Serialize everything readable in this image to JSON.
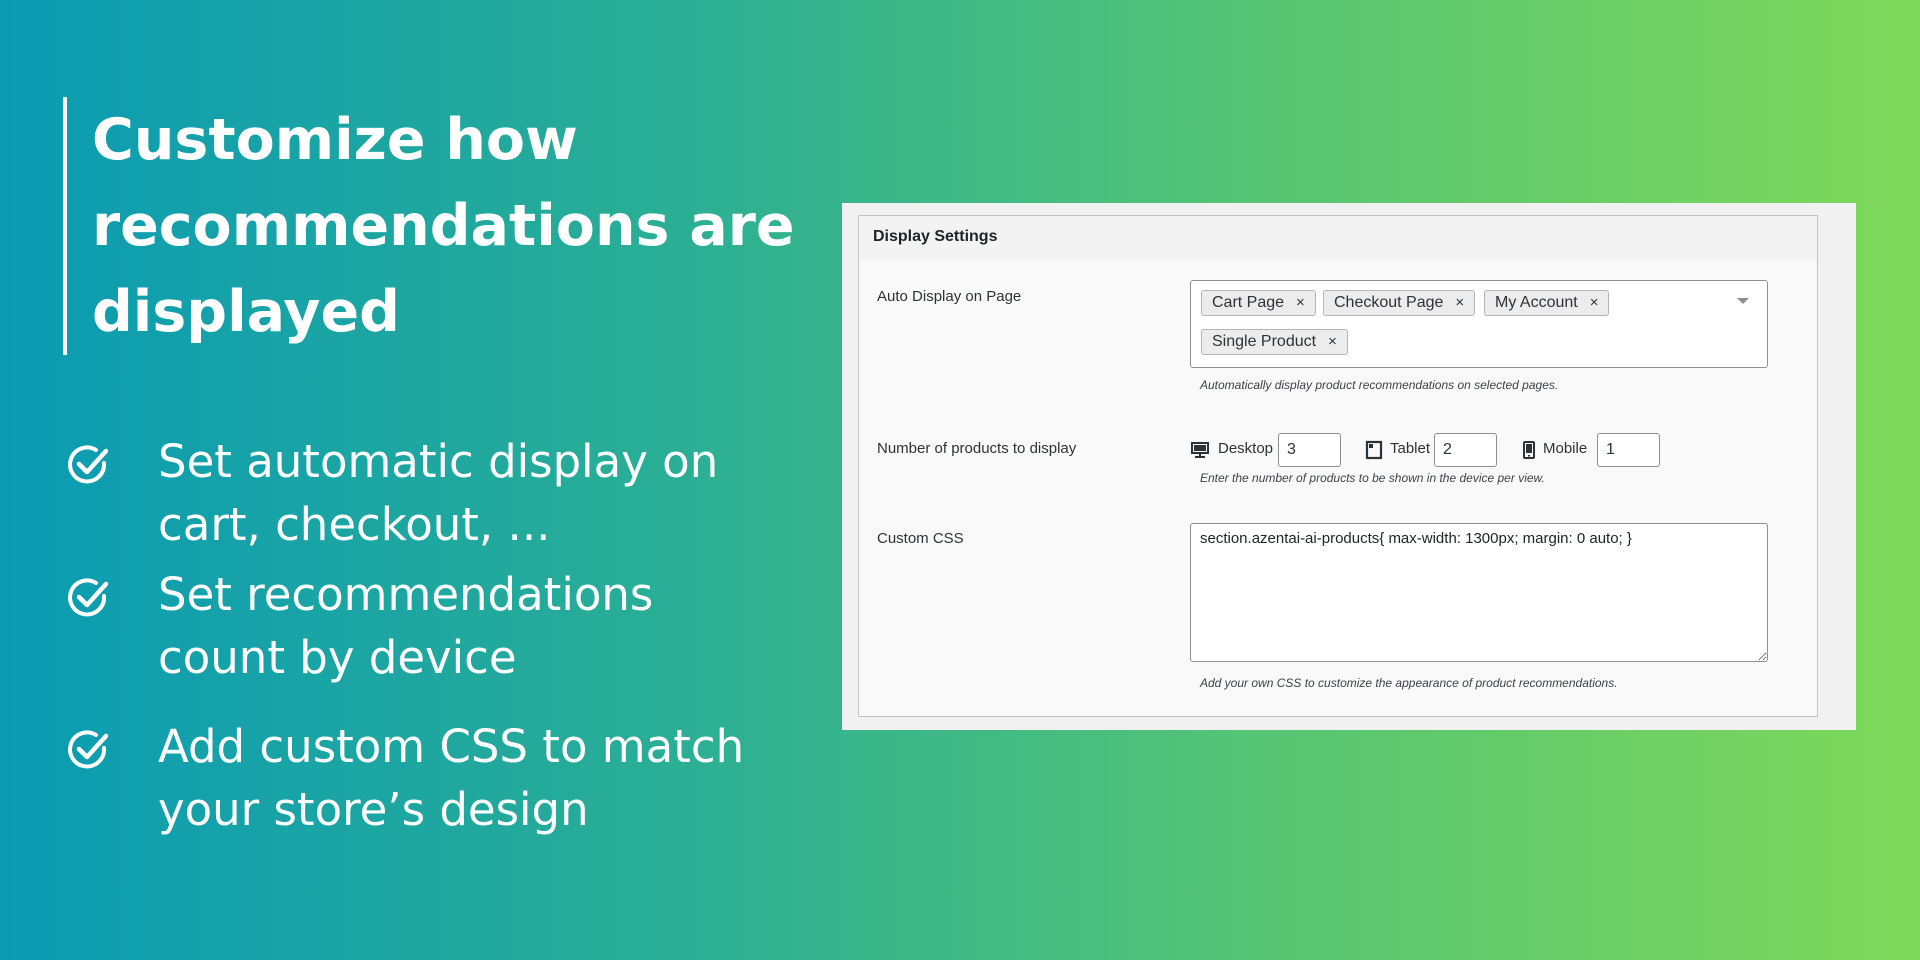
{
  "hero": {
    "title_line1": "Customize how",
    "title_line2": "recommendations are",
    "title_line3": "displayed"
  },
  "features": [
    {
      "line1": "Set automatic display on",
      "line2": "cart, checkout, ..."
    },
    {
      "line1": "Set recommendations",
      "line2": "count by device"
    },
    {
      "line1": "Add custom CSS to match",
      "line2": "your store’s design"
    }
  ],
  "panel": {
    "title": "Display Settings",
    "auto_display": {
      "label": "Auto Display on Page",
      "chips": [
        "Cart Page",
        "Checkout Page",
        "My Account",
        "Single Product"
      ],
      "remove_glyph": "×",
      "hint": "Automatically display product recommendations on selected pages."
    },
    "num_products": {
      "label": "Number of products to display",
      "devices": [
        {
          "name": "Desktop",
          "value": "3",
          "icon": "desktop-icon"
        },
        {
          "name": "Tablet",
          "value": "2",
          "icon": "tablet-icon"
        },
        {
          "name": "Mobile",
          "value": "1",
          "icon": "mobile-icon"
        }
      ],
      "hint": "Enter the number of products to be shown in the device per view."
    },
    "custom_css": {
      "label": "Custom CSS",
      "value": "section.azentai-ai-products{ max-width: 1300px; margin: 0 auto; }",
      "hint": "Add your own CSS to customize the appearance of product recommendations."
    }
  },
  "colors": {
    "gradient_start": "#0a9bb3",
    "gradient_end": "#7fd85a",
    "text_white": "#ffffff",
    "panel_bg": "#f9f9f9"
  }
}
